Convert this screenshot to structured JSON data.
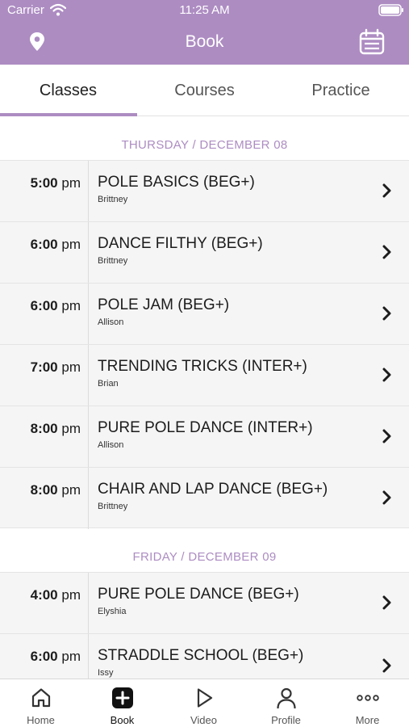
{
  "status_bar": {
    "carrier": "Carrier",
    "time": "11:25 AM"
  },
  "nav": {
    "title": "Book"
  },
  "tabs": [
    {
      "label": "Classes",
      "active": true
    },
    {
      "label": "Courses",
      "active": false
    },
    {
      "label": "Practice",
      "active": false
    }
  ],
  "days": [
    {
      "header": "THURSDAY / DECEMBER 08",
      "classes": [
        {
          "time": "5:00",
          "ampm": "pm",
          "name": "POLE BASICS (BEG+)",
          "instructor": "Brittney"
        },
        {
          "time": "6:00",
          "ampm": "pm",
          "name": "DANCE FILTHY (BEG+)",
          "instructor": "Brittney"
        },
        {
          "time": "6:00",
          "ampm": "pm",
          "name": "POLE JAM (BEG+)",
          "instructor": "Allison"
        },
        {
          "time": "7:00",
          "ampm": "pm",
          "name": "TRENDING TRICKS (INTER+)",
          "instructor": "Brian"
        },
        {
          "time": "8:00",
          "ampm": "pm",
          "name": "PURE POLE DANCE (INTER+)",
          "instructor": "Allison"
        },
        {
          "time": "8:00",
          "ampm": "pm",
          "name": "CHAIR AND LAP DANCE (BEG+)",
          "instructor": "Brittney"
        }
      ]
    },
    {
      "header": "FRIDAY / DECEMBER 09",
      "classes": [
        {
          "time": "4:00",
          "ampm": "pm",
          "name": "PURE POLE DANCE (BEG+)",
          "instructor": "Elyshia"
        },
        {
          "time": "6:00",
          "ampm": "pm",
          "name": "STRADDLE SCHOOL (BEG+)",
          "instructor": "Issy"
        }
      ]
    }
  ],
  "tabbar": [
    {
      "label": "Home",
      "icon": "home-icon",
      "active": false
    },
    {
      "label": "Book",
      "icon": "book-plus-icon",
      "active": true
    },
    {
      "label": "Video",
      "icon": "play-icon",
      "active": false
    },
    {
      "label": "Profile",
      "icon": "person-icon",
      "active": false
    },
    {
      "label": "More",
      "icon": "more-dots-icon",
      "active": false
    }
  ],
  "colors": {
    "accent": "#ad8cc2",
    "row_bg": "#f5f5f5"
  }
}
